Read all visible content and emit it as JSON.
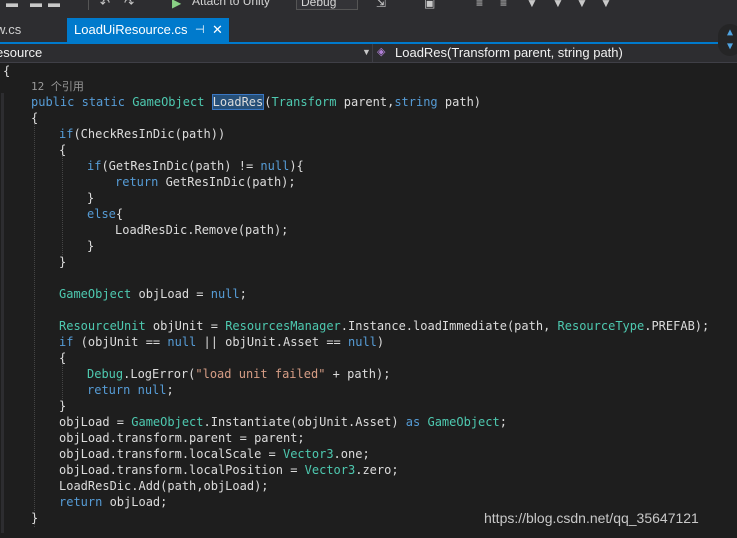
{
  "toolbar": {
    "attach_label": "Attach to Unity",
    "config_value": "Debug"
  },
  "tabs": [
    {
      "label": "w.cs"
    },
    {
      "label": "LoadUiResource.cs"
    }
  ],
  "navbar": {
    "type_label": "esource",
    "member_label": "LoadRes(Transform parent, string path)"
  },
  "codelens": "12 个引用",
  "code": [
    {
      "text": "{"
    },
    {
      "text": "public static GameObject LoadRes(Transform parent,string path)"
    },
    {
      "text": "{"
    },
    {
      "text": "if(CheckResInDic(path))"
    },
    {
      "text": "{"
    },
    {
      "text": "if(GetResInDic(path) != null){"
    },
    {
      "text": "return GetResInDic(path);"
    },
    {
      "text": "}"
    },
    {
      "text": "else{"
    },
    {
      "text": "LoadResDic.Remove(path);"
    },
    {
      "text": "}"
    },
    {
      "text": "}"
    },
    {
      "text": ""
    },
    {
      "text": "GameObject objLoad = null;"
    },
    {
      "text": ""
    },
    {
      "text": "ResourceUnit objUnit = ResourcesManager.Instance.loadImmediate(path, ResourceType.PREFAB);"
    },
    {
      "text": "if (objUnit == null || objUnit.Asset == null)"
    },
    {
      "text": "{"
    },
    {
      "text": "Debug.LogError(\"load unit failed\" + path);"
    },
    {
      "text": "return null;"
    },
    {
      "text": "}"
    },
    {
      "text": "objLoad = GameObject.Instantiate(objUnit.Asset) as GameObject;"
    },
    {
      "text": "objLoad.transform.parent = parent;"
    },
    {
      "text": "objLoad.transform.localScale = Vector3.one;"
    },
    {
      "text": "objLoad.transform.localPosition = Vector3.zero;"
    },
    {
      "text": "LoadResDic.Add(path,objLoad);"
    },
    {
      "text": "return objLoad;"
    },
    {
      "text": "}"
    }
  ],
  "watermark": "https://blog.csdn.net/qq_35647121",
  "colors": {
    "editor_bg": "#1e1e1e",
    "keyword": "#569cd6",
    "type": "#4ec9b0",
    "string": "#d69d85",
    "accent": "#007acc"
  }
}
